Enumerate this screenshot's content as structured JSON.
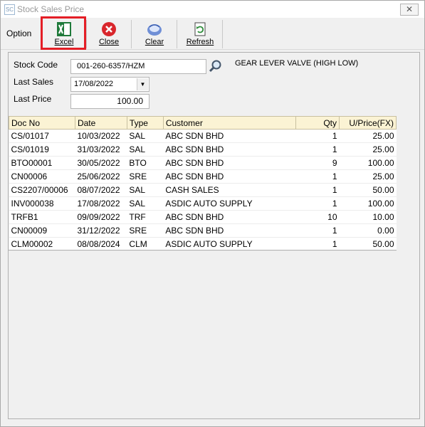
{
  "window": {
    "title": "Stock Sales Price",
    "close_symbol": "✕"
  },
  "toolbar": {
    "option_label": "Option",
    "buttons": [
      {
        "label": "Excel",
        "icon": "excel-icon"
      },
      {
        "label": "Close",
        "icon": "close-circle-icon"
      },
      {
        "label": "Clear",
        "icon": "clear-icon"
      },
      {
        "label": "Refresh",
        "icon": "refresh-icon"
      }
    ]
  },
  "form": {
    "stock_code_label": "Stock Code",
    "stock_code_value": "001-260-6357/HZM",
    "description": "GEAR LEVER VALVE (HIGH LOW)",
    "last_sales_label": "Last Sales",
    "last_sales_value": "17/08/2022",
    "last_price_label": "Last Price",
    "last_price_value": "100.00"
  },
  "table": {
    "headers": [
      "Doc No",
      "Date",
      "Type",
      "Customer",
      "Qty",
      "U/Price(FX)"
    ],
    "rows": [
      [
        "CS/01017",
        "10/03/2022",
        "SAL",
        "ABC SDN BHD",
        "1",
        "25.00"
      ],
      [
        "CS/01019",
        "31/03/2022",
        "SAL",
        "ABC SDN BHD",
        "1",
        "25.00"
      ],
      [
        "BTO00001",
        "30/05/2022",
        "BTO",
        "ABC SDN BHD",
        "9",
        "100.00"
      ],
      [
        "CN00006",
        "25/06/2022",
        "SRE",
        "ABC SDN BHD",
        "1",
        "25.00"
      ],
      [
        "CS2207/00006",
        "08/07/2022",
        "SAL",
        "CASH SALES",
        "1",
        "50.00"
      ],
      [
        "INV000038",
        "17/08/2022",
        "SAL",
        "ASDIC AUTO SUPPLY",
        "1",
        "100.00"
      ],
      [
        "TRFB1",
        "09/09/2022",
        "TRF",
        "ABC SDN BHD",
        "10",
        "10.00"
      ],
      [
        "CN00009",
        "31/12/2022",
        "SRE",
        "ABC SDN BHD",
        "1",
        "0.00"
      ],
      [
        "CLM00002",
        "08/08/2024",
        "CLM",
        "ASDIC AUTO SUPPLY",
        "1",
        "50.00"
      ]
    ]
  }
}
